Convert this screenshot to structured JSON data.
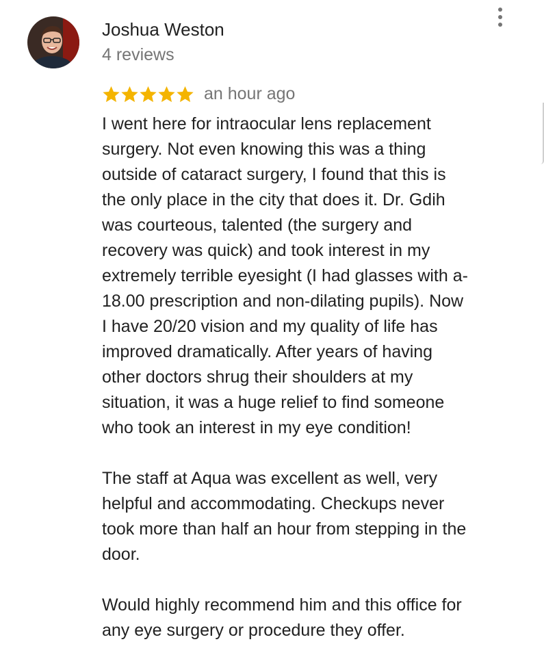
{
  "reviewer": {
    "name": "Joshua Weston",
    "review_count": "4 reviews",
    "avatar_icon": "person-photo"
  },
  "menu": {
    "icon": "more-vert-icon"
  },
  "rating": {
    "stars": 5,
    "max_stars": 5,
    "star_color": "#F4B400",
    "time": "an hour ago"
  },
  "review": {
    "paragraphs": [
      [
        "I went here for intraocular lens replacement",
        "surgery. Not even knowing this was a thing",
        "outside of cataract surgery, I found that this is",
        "the only place in the city that does it. Dr. Gdih",
        "was courteous, talented (the surgery and",
        "recovery was quick) and took interest in my",
        "extremely terrible eyesight (I had glasses with a-",
        "18.00 prescription and non-dilating pupils). Now",
        "I have 20/20 vision and my quality of life has",
        "improved dramatically. After years of having",
        "other doctors shrug their shoulders at my",
        "situation, it was a huge relief to find someone",
        "who took an interest in my eye condition!"
      ],
      [
        "The staff at Aqua was excellent as well, very",
        "helpful and accommodating. Checkups never",
        "took more than half an hour from stepping in the",
        "door."
      ],
      [
        "Would highly recommend him and this office for",
        "any eye surgery or procedure they offer."
      ]
    ]
  }
}
